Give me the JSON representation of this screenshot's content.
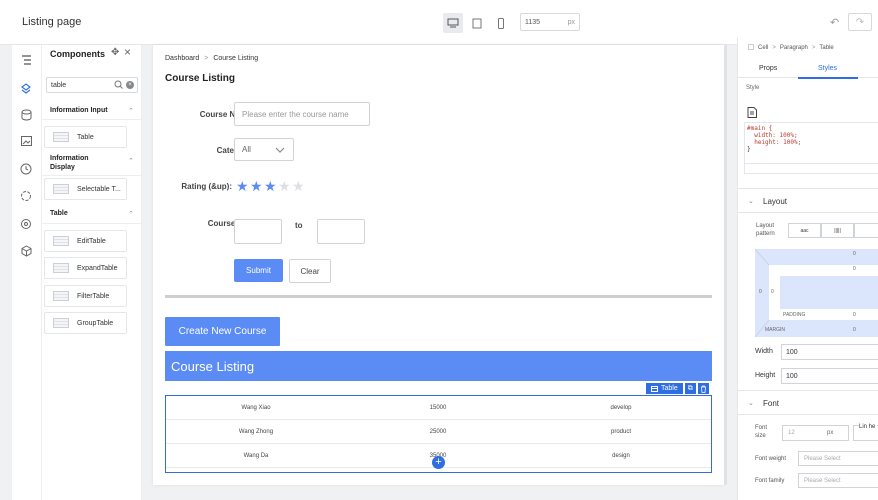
{
  "app": {
    "title": "Listing page"
  },
  "toolbar": {
    "width_value": "1135",
    "width_unit": "px",
    "undo": "↶",
    "redo": "↷"
  },
  "components_panel": {
    "title": "Components",
    "search_value": "table",
    "groups": [
      {
        "label": "Information Input",
        "items": [
          "Table"
        ]
      },
      {
        "label": "Information Display",
        "items": [
          "Selectable T..."
        ]
      },
      {
        "label": "Table",
        "items": [
          "EditTable",
          "ExpandTable",
          "FilterTable",
          "GroupTable"
        ]
      }
    ]
  },
  "canvas": {
    "breadcrumb": [
      "Dashboard",
      "Course Listing"
    ],
    "page_title": "Course Listing",
    "form": {
      "course_name_label": "Course Name:",
      "course_name_placeholder": "Please enter the course name",
      "category_label": "Category:",
      "category_value": "All",
      "rating_label": "Rating (&up):",
      "rating_value": 3,
      "rating_max": 5,
      "fee_label": "Course Fee:",
      "fee_min": "",
      "fee_max": "",
      "to_label": "to",
      "submit_label": "Submit",
      "clear_label": "Clear"
    },
    "create_button": "Create New Course",
    "list_title": "Course Listing",
    "selection_tag": "Table",
    "table_rows": [
      {
        "name": "Wang Xiao",
        "fee": "15000",
        "category": "develop"
      },
      {
        "name": "Wang Zhong",
        "fee": "25000",
        "category": "product"
      },
      {
        "name": "Wang Da",
        "fee": "35000",
        "category": "design"
      }
    ]
  },
  "props_panel": {
    "breadcrumb": [
      "Cell",
      "Paragraph",
      "Table"
    ],
    "tabs": [
      "Props",
      "Styles"
    ],
    "active_tab": "Styles",
    "style_label": "Style",
    "code_lines": [
      "#main {",
      "  width: 100%;",
      "  height: 100%;",
      "}"
    ],
    "layout_section": "Layout",
    "layout_pattern_label": "Layout pattern",
    "layout_options": [
      "aac",
      "|||||",
      ""
    ],
    "box_model": {
      "margin_label": "MARGIN",
      "padding_label": "PADDING",
      "values": [
        "0",
        "0",
        "0",
        "0",
        "0",
        "0"
      ]
    },
    "width_label": "Width",
    "width_value": "100",
    "height_label": "Height",
    "height_value": "100",
    "font_section": "Font",
    "font_size_label": "Font size",
    "font_size_value": "12",
    "font_size_unit": "px",
    "line_height_label": "Lin he",
    "font_weight_label": "Font weight",
    "font_weight_placeholder": "Please Select",
    "font_family_label": "Font family",
    "font_family_placeholder": "Please Select"
  }
}
